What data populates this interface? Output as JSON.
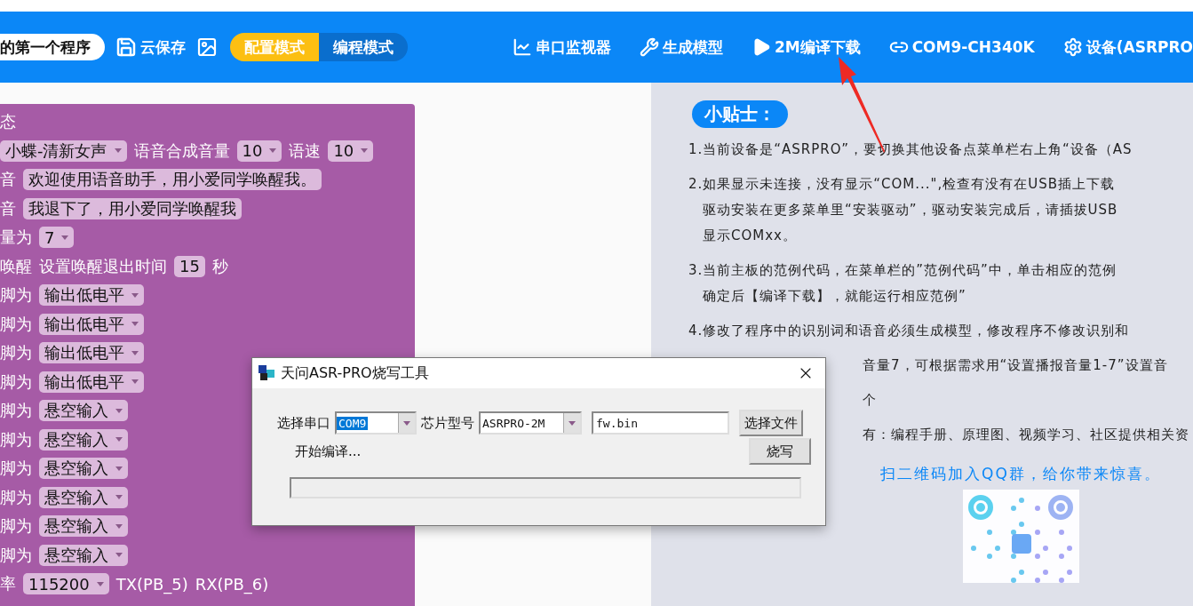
{
  "header": {
    "file_name": "的第一个程序",
    "save_label": "云保存",
    "modes": [
      {
        "label": "配置模式",
        "selected": true
      },
      {
        "label": "编程模式",
        "selected": false
      }
    ],
    "menu": [
      {
        "kind": "chart",
        "label": "串口监视器"
      },
      {
        "kind": "tools",
        "label": "生成模型"
      },
      {
        "kind": "play",
        "label": "2M编译下载"
      },
      {
        "kind": "link",
        "label": "COM9-CH340K"
      },
      {
        "kind": "gear",
        "label": "设备(ASRPRO"
      }
    ]
  },
  "blocks": [
    [
      {
        "kind": "text",
        "text": "态"
      }
    ],
    [
      {
        "kind": "dropdown",
        "text": "小蝶-清新女声"
      },
      {
        "kind": "text",
        "text": "语音合成音量"
      },
      {
        "kind": "dropdown",
        "text": "10"
      },
      {
        "kind": "text",
        "text": "语速"
      },
      {
        "kind": "dropdown",
        "text": "10"
      }
    ],
    [
      {
        "kind": "text",
        "text": "音"
      },
      {
        "kind": "field",
        "text": "欢迎使用语音助手，用小爱同学唤醒我。"
      }
    ],
    [
      {
        "kind": "text",
        "text": "音"
      },
      {
        "kind": "field",
        "text": "我退下了，用小爱同学唤醒我"
      }
    ],
    [
      {
        "kind": "text",
        "text": "量为"
      },
      {
        "kind": "dropdown",
        "text": "7"
      }
    ],
    [
      {
        "kind": "text",
        "text": "唤醒"
      },
      {
        "kind": "text",
        "text": "设置唤醒退出时间"
      },
      {
        "kind": "field",
        "text": "15"
      },
      {
        "kind": "text",
        "text": "秒"
      }
    ],
    [
      {
        "kind": "text",
        "text": "脚为"
      },
      {
        "kind": "dropdown",
        "text": "输出低电平"
      }
    ],
    [
      {
        "kind": "text",
        "text": "脚为"
      },
      {
        "kind": "dropdown",
        "text": "输出低电平"
      }
    ],
    [
      {
        "kind": "text",
        "text": "脚为"
      },
      {
        "kind": "dropdown",
        "text": "输出低电平"
      }
    ],
    [
      {
        "kind": "text",
        "text": "脚为"
      },
      {
        "kind": "dropdown",
        "text": "输出低电平"
      }
    ],
    [
      {
        "kind": "text",
        "text": "脚为"
      },
      {
        "kind": "dropdown",
        "text": "悬空输入"
      }
    ],
    [
      {
        "kind": "text",
        "text": "脚为"
      },
      {
        "kind": "dropdown",
        "text": "悬空输入"
      }
    ],
    [
      {
        "kind": "text",
        "text": "脚为"
      },
      {
        "kind": "dropdown",
        "text": "悬空输入"
      }
    ],
    [
      {
        "kind": "text",
        "text": "脚为"
      },
      {
        "kind": "dropdown",
        "text": "悬空输入"
      }
    ],
    [
      {
        "kind": "text",
        "text": "脚为"
      },
      {
        "kind": "dropdown",
        "text": "悬空输入"
      }
    ],
    [
      {
        "kind": "text",
        "text": "脚为"
      },
      {
        "kind": "dropdown",
        "text": "悬空输入"
      }
    ],
    [
      {
        "kind": "text",
        "text": "率"
      },
      {
        "kind": "dropdown",
        "text": "115200"
      },
      {
        "kind": "text",
        "text": "TX(PB_5)"
      },
      {
        "kind": "text",
        "text": "RX(PB_6)"
      }
    ]
  ],
  "tips": {
    "title": "小贴士：",
    "items": [
      {
        "kind": "full",
        "lines": [
          "1.当前设备是“ASRPRO”，要切换其他设备点菜单栏右上角“设备（AS"
        ]
      },
      {
        "kind": "full",
        "lines": [
          "2.如果显示未连接，没有显示“COM...\",检查有没有在USB插上下载",
          "驱动安装在更多菜单里“安装驱动”，驱动安装完成后，请插拔USB",
          "显示COMxx。"
        ]
      },
      {
        "kind": "full",
        "lines": [
          "3.当前主板的范例代码，在菜单栏的”范例代码”中，单击相应的范例",
          "确定后【编译下载】，就能运行相应范例”"
        ]
      },
      {
        "kind": "full",
        "lines": [
          "4.修改了程序中的识别词和语音必须生成模型，修改程序不修改识别和"
        ]
      },
      {
        "kind": "partial",
        "lines": [
          "音量7，可根据需求用“设置播报音量1-7”设置音"
        ]
      },
      {
        "kind": "partial",
        "lines": [
          "个"
        ]
      },
      {
        "kind": "partial",
        "lines": [
          "有：编程手册、原理图、视频学习、社区提供相关资"
        ]
      }
    ],
    "qr_caption": "扫二维码加入QQ群，给你带来惊喜。"
  },
  "dialog": {
    "title": "天问ASR-PRO烧写工具",
    "port_label": "选择串口",
    "port": "COM9",
    "chip_label": "芯片型号",
    "chip": "ASRPRO-2M",
    "file": "fw.bin",
    "choose_button": "选择文件",
    "burn_button": "烧写",
    "status": "开始编译...",
    "progress": {
      "level": 0
    }
  }
}
